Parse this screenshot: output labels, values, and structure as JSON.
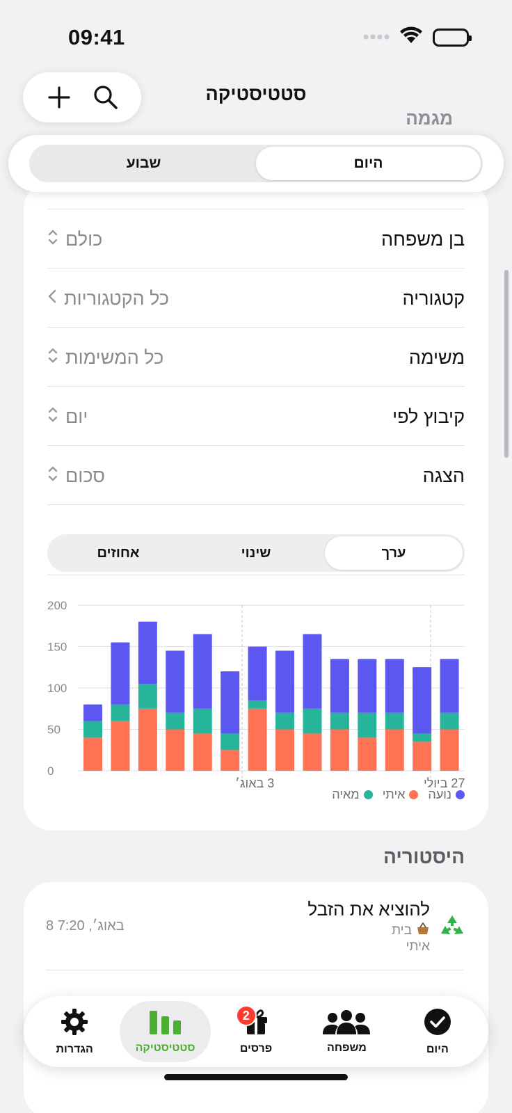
{
  "status_bar": {
    "time": "09:41"
  },
  "header": {
    "title": "סטטיסטיקה",
    "behind": "מגמה"
  },
  "period_tabs": [
    {
      "label": "היום",
      "active": true
    },
    {
      "label": "שבוע",
      "active": false
    }
  ],
  "filters": [
    {
      "label": "בן משפחה",
      "value": "כולם",
      "control": "updown"
    },
    {
      "label": "קטגוריה",
      "value": "כל הקטגוריות",
      "control": "chevron"
    },
    {
      "label": "משימה",
      "value": "כל המשימות",
      "control": "updown"
    },
    {
      "label": "קיבוץ לפי",
      "value": "יום",
      "control": "updown"
    },
    {
      "label": "הצגה",
      "value": "סכום",
      "control": "updown"
    }
  ],
  "metric_tabs": [
    {
      "label": "ערך",
      "active": true
    },
    {
      "label": "שינוי",
      "active": false
    },
    {
      "label": "אחוזים",
      "active": false
    }
  ],
  "colors": {
    "noa": "#5b57f0",
    "itai": "#ff7254",
    "maya": "#26b49a",
    "accent_green": "#4caf2f"
  },
  "chart_data": {
    "type": "bar",
    "stacked": true,
    "ylim": [
      0,
      200
    ],
    "yticks": [
      "0",
      "50",
      "100",
      "150",
      "200"
    ],
    "x_labels": [
      {
        "text": "3 באוג׳"
      },
      {
        "text": "27 ביולי"
      }
    ],
    "series": [
      {
        "name": "איתי",
        "color": "#ff7254",
        "values": [
          40,
          60,
          75,
          50,
          45,
          25,
          75,
          50,
          45,
          50,
          40,
          50,
          35,
          50
        ]
      },
      {
        "name": "מאיה",
        "color": "#26b49a",
        "values": [
          20,
          20,
          30,
          20,
          30,
          20,
          10,
          20,
          30,
          20,
          30,
          20,
          10,
          20
        ]
      },
      {
        "name": "נועה",
        "color": "#5b57f0",
        "values": [
          20,
          75,
          75,
          75,
          90,
          75,
          65,
          75,
          90,
          65,
          65,
          65,
          80,
          65
        ]
      }
    ],
    "legend": [
      "נועה",
      "איתי",
      "מאיה"
    ]
  },
  "history": {
    "title": "היסטוריה",
    "items": [
      {
        "title": "להוציא את הזבל",
        "category": "בית",
        "person": "איתי",
        "time": "8 באוג׳, 7:20"
      }
    ]
  },
  "tabbar": [
    {
      "label": "היום",
      "icon": "checkmark-icon",
      "active": false
    },
    {
      "label": "משפחה",
      "icon": "family-icon",
      "active": false
    },
    {
      "label": "פרסים",
      "icon": "gift-icon",
      "active": false,
      "badge": "2"
    },
    {
      "label": "סטטיסטיקה",
      "icon": "stats-icon",
      "active": true
    },
    {
      "label": "הגדרות",
      "icon": "gear-icon",
      "active": false
    }
  ]
}
